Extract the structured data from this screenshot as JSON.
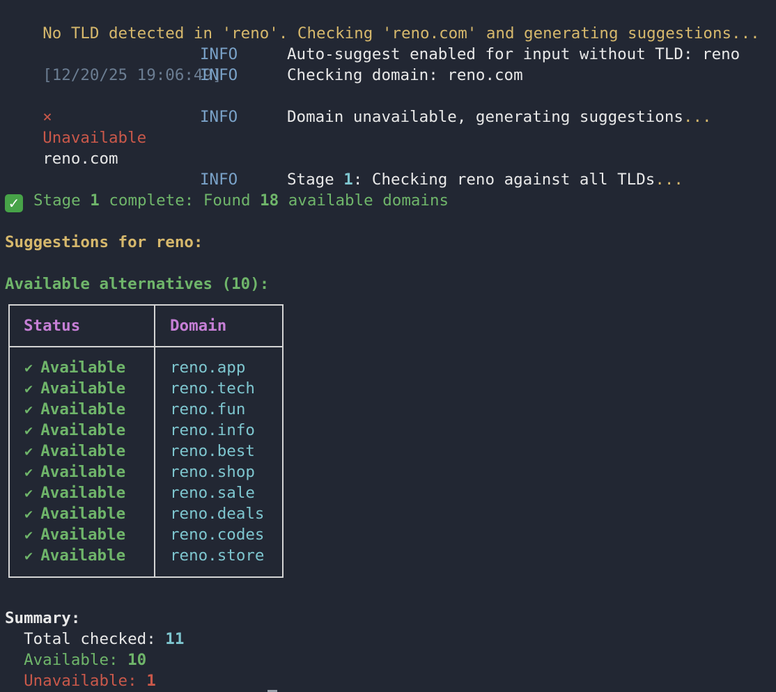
{
  "header_line": "No TLD detected in 'reno'. Checking 'reno.com' and generating suggestions...",
  "log": {
    "timestamp": "[12/20/25 19:06:49]",
    "level": "INFO",
    "line1": "Auto-suggest enabled for input without TLD: reno",
    "line2": "Checking domain: reno.com",
    "unavailable_mark": "×",
    "unavailable_label": "Unavailable",
    "unavailable_domain": "reno.com",
    "line3_text": "Domain unavailable, generating suggestions",
    "ellipsis": "...",
    "stage_prefix": "Stage ",
    "stage_num": "1",
    "stage_suffix": ": Checking reno against all TLDs"
  },
  "stage_complete": {
    "emoji": "✓",
    "text1": "Stage ",
    "num1": "1",
    "text2": " complete: Found ",
    "num2": "18",
    "text3": " available domains"
  },
  "suggestions_title": "Suggestions for reno:",
  "alternatives_title": "Available alternatives (10):",
  "table": {
    "headers": [
      "Status",
      "Domain"
    ],
    "check_glyph": "✔",
    "rows": [
      {
        "status": "Available",
        "domain": "reno.app"
      },
      {
        "status": "Available",
        "domain": "reno.tech"
      },
      {
        "status": "Available",
        "domain": "reno.fun"
      },
      {
        "status": "Available",
        "domain": "reno.info"
      },
      {
        "status": "Available",
        "domain": "reno.best"
      },
      {
        "status": "Available",
        "domain": "reno.shop"
      },
      {
        "status": "Available",
        "domain": "reno.sale"
      },
      {
        "status": "Available",
        "domain": "reno.deals"
      },
      {
        "status": "Available",
        "domain": "reno.codes"
      },
      {
        "status": "Available",
        "domain": "reno.store"
      }
    ]
  },
  "summary": {
    "title": "Summary:",
    "total_label": "  Total checked: ",
    "total_value": "11",
    "available_label": "  Available: ",
    "available_value": "10",
    "unavailable_label": "  Unavailable: ",
    "unavailable_value": "1"
  },
  "colors": {
    "background": "#222733",
    "yellow": "#d6b86c",
    "green": "#6fb56a",
    "cyan": "#7ec6cf",
    "red": "#c9584a",
    "magenta": "#c67fd6",
    "info_blue": "#7aa2c8"
  }
}
